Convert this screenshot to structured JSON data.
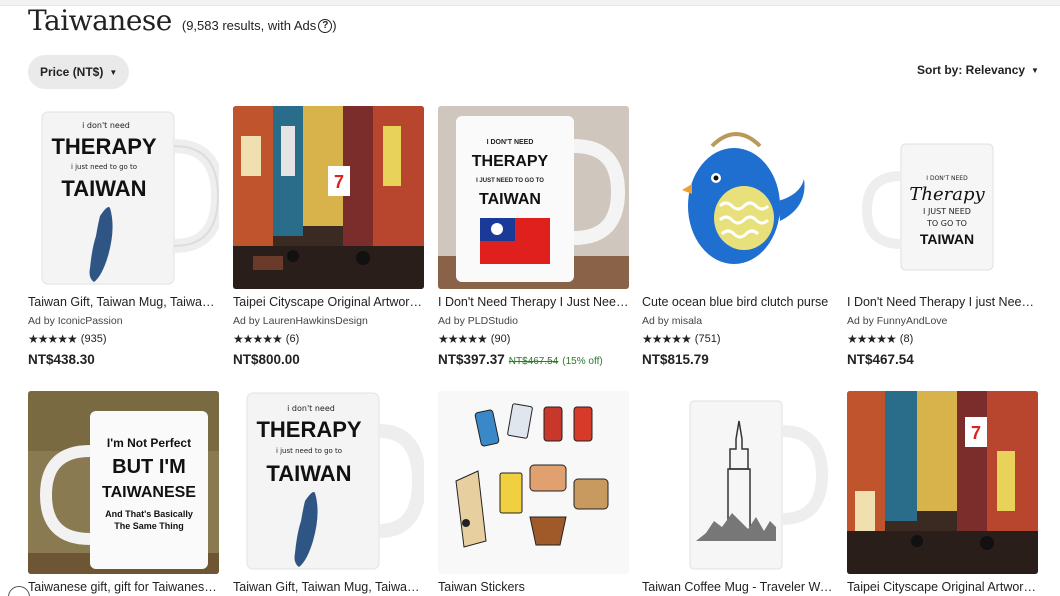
{
  "header": {
    "title": "Taiwanese",
    "results": "(9,583 results, with Ads",
    "help_icon": "question-circle-icon"
  },
  "filters": {
    "price_label": "Price (NT$)"
  },
  "sort": {
    "label": "Sort by: Relevancy"
  },
  "products": [
    {
      "title": "Taiwan Gift, Taiwan Mug, Taiwan ...",
      "ad_by": "Ad by IconicPassion",
      "stars": "★★★★★",
      "reviews": "(935)",
      "price": "NT$438.30"
    },
    {
      "title": "Taipei Cityscape Original Artwork ...",
      "ad_by": "Ad by LaurenHawkinsDesign",
      "stars": "★★★★★",
      "reviews": "(6)",
      "price": "NT$800.00"
    },
    {
      "title": "I Don't Need Therapy I Just Need T...",
      "ad_by": "Ad by PLDStudio",
      "stars": "★★★★★",
      "reviews": "(90)",
      "price": "NT$397.37",
      "original_price": "NT$467.54",
      "discount": "(15% off)"
    },
    {
      "title": "Cute ocean blue bird clutch purse",
      "ad_by": "Ad by misala",
      "stars": "★★★★★",
      "reviews": "(751)",
      "price": "NT$815.79"
    },
    {
      "title": "I Don't Need Therapy I just Need t...",
      "ad_by": "Ad by FunnyAndLove",
      "stars": "★★★★★",
      "reviews": "(8)",
      "price": "NT$467.54"
    },
    {
      "title": "Taiwanese gift, gift for Taiwanese,..."
    },
    {
      "title": "Taiwan Gift, Taiwan Mug, Taiwan ..."
    },
    {
      "title": "Taiwan Stickers"
    },
    {
      "title": "Taiwan Coffee Mug - Traveler Wan..."
    },
    {
      "title": "Taipei Cityscape Original Artwork ..."
    }
  ],
  "image_text": {
    "mug1": [
      "i don't need",
      "THERAPY",
      "i just need to go to",
      "TAIWAN"
    ],
    "mug3": [
      "I DON'T NEED",
      "THERAPY",
      "I JUST NEED TO GO TO",
      "TAIWAN"
    ],
    "mug5": [
      "I DON'T NEED",
      "Therapy",
      "I JUST NEED",
      "TO GO TO",
      "TAIWAN"
    ],
    "mug6": [
      "I'm Not Perfect",
      "BUT I'M",
      "TAIWANESE",
      "And That's Basically",
      "The Same Thing"
    ],
    "sign": "7"
  },
  "colors": {
    "accent": "#222222",
    "discount_green": "#2c7a2c",
    "chip_bg": "#eaeaea"
  }
}
